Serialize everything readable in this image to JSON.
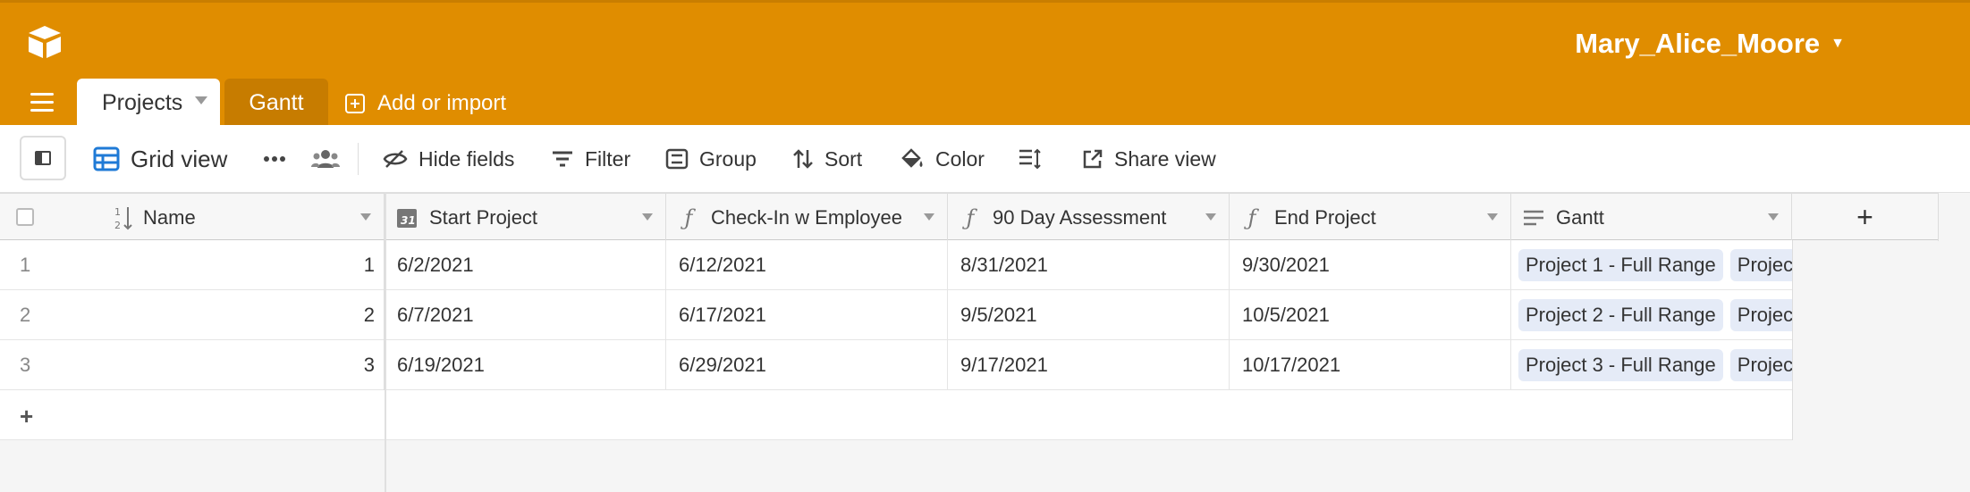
{
  "header": {
    "user_name": "Mary_Alice_Moore",
    "brand_color": "#e08d00"
  },
  "tabs": [
    {
      "label": "Projects",
      "active": true
    },
    {
      "label": "Gantt",
      "active": false
    }
  ],
  "add_import_label": "Add or import",
  "toolbar": {
    "grid_view_label": "Grid view",
    "hide_fields_label": "Hide fields",
    "filter_label": "Filter",
    "group_label": "Group",
    "sort_label": "Sort",
    "color_label": "Color",
    "share_view_label": "Share view"
  },
  "columns": [
    {
      "label": "Name",
      "icon": "sort-number-icon"
    },
    {
      "label": "Start Project",
      "icon": "calendar-icon"
    },
    {
      "label": "Check-In w Employee",
      "icon": "formula-icon"
    },
    {
      "label": "90 Day Assessment",
      "icon": "formula-icon"
    },
    {
      "label": "End Project",
      "icon": "formula-icon"
    },
    {
      "label": "Gantt",
      "icon": "long-text-icon"
    }
  ],
  "rows": [
    {
      "num": "1",
      "name": "1",
      "start": "6/2/2021",
      "checkin": "6/12/2021",
      "assessment": "8/31/2021",
      "end": "9/30/2021",
      "gantt_a": "Project 1 - Full Range",
      "gantt_b": "Project"
    },
    {
      "num": "2",
      "name": "2",
      "start": "6/7/2021",
      "checkin": "6/17/2021",
      "assessment": "9/5/2021",
      "end": "10/5/2021",
      "gantt_a": "Project 2 - Full Range",
      "gantt_b": "Project"
    },
    {
      "num": "3",
      "name": "3",
      "start": "6/19/2021",
      "checkin": "6/29/2021",
      "assessment": "9/17/2021",
      "end": "10/17/2021",
      "gantt_a": "Project 3 - Full Range",
      "gantt_b": "Project"
    }
  ],
  "add_row_symbol": "+",
  "add_field_symbol": "+"
}
